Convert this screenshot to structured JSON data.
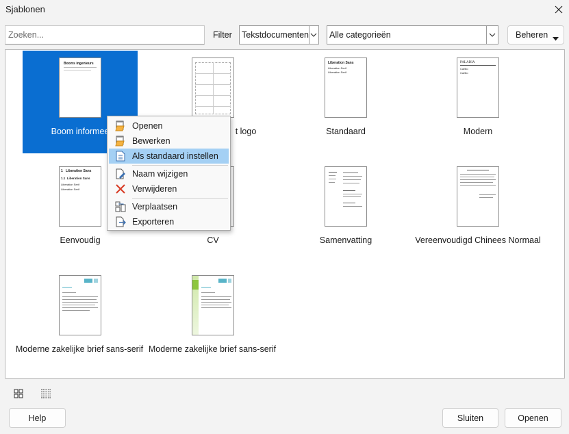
{
  "window": {
    "title": "Sjablonen"
  },
  "search": {
    "placeholder": "Zoeken..."
  },
  "filter": {
    "label": "Filter",
    "type_value": "Tekstdocumenten",
    "category_value": "Alle categorieën"
  },
  "manage": {
    "label": "Beheren"
  },
  "templates": [
    {
      "name": "Boom informee",
      "selected": true
    },
    {
      "name": "t logo"
    },
    {
      "name": "Standaard"
    },
    {
      "name": "Modern"
    },
    {
      "name": "Eenvoudig"
    },
    {
      "name": "CV"
    },
    {
      "name": "Samenvatting"
    },
    {
      "name": "Vereenvoudigd Chinees Normaal"
    },
    {
      "name": "Moderne zakelijke brief sans-serif"
    },
    {
      "name": "Moderne zakelijke brief sans-serif"
    }
  ],
  "thumb_text": {
    "boom_heading": "Booms ingenieurs",
    "std_heading": "Liberation Sans",
    "std_line": "Liberation Serif",
    "modern_heading": "PALADIA",
    "modern_line": "Carlito",
    "simple_h1": "Liberation Sans",
    "simple_h2": "Liberation Sans",
    "simple_line": "Liberation Serif"
  },
  "context_menu": {
    "items": [
      {
        "label": "Openen",
        "mnemonic": "O",
        "icon": "open-folder-icon"
      },
      {
        "label": "Bewerken",
        "mnemonic": "B",
        "icon": "edit-folder-icon"
      },
      {
        "label": "Als standaard instellen",
        "mnemonic": "a",
        "icon": "document-icon",
        "highlighted": true
      },
      {
        "label": "Naam wijzigen",
        "mnemonic": "N",
        "icon": "rename-icon"
      },
      {
        "label": "Verwijderen",
        "mnemonic": "V",
        "icon": "delete-x-icon"
      },
      {
        "label": "Verplaatsen",
        "mnemonic": "p",
        "icon": "move-icon"
      },
      {
        "label": "Exporteren",
        "mnemonic": "E",
        "icon": "export-icon"
      }
    ]
  },
  "footer": {
    "help": "Help",
    "close": "Sluiten",
    "open": "Openen"
  },
  "colors": {
    "selection": "#0a6ed1",
    "menu_highlight": "#a4d0f4"
  }
}
